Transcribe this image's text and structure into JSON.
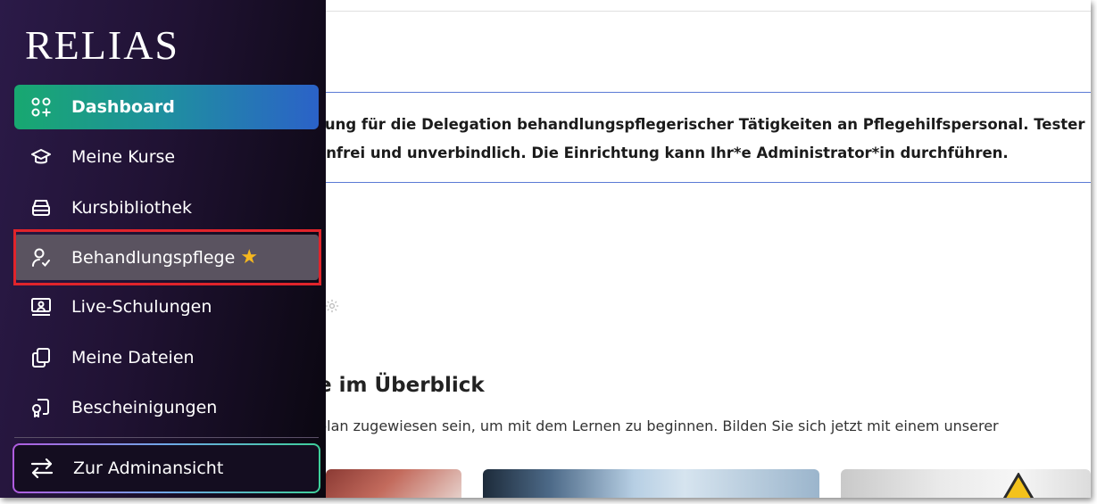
{
  "sidebar": {
    "logo": "RELIAS",
    "items": [
      {
        "label": "Dashboard",
        "icon": "dashboard-icon"
      },
      {
        "label": "Meine Kurse",
        "icon": "graduation-cap-icon"
      },
      {
        "label": "Kursbibliothek",
        "icon": "library-icon"
      },
      {
        "label": "Behandlungspflege",
        "icon": "user-check-icon",
        "badge": "★"
      },
      {
        "label": "Live-Schulungen",
        "icon": "live-training-icon"
      },
      {
        "label": "Meine Dateien",
        "icon": "files-icon"
      },
      {
        "label": "Bescheinigungen",
        "icon": "certificate-icon"
      }
    ],
    "admin_button": {
      "label": "Zur Adminansicht",
      "icon": "switch-arrows-icon"
    },
    "colors": {
      "active_start": "#18a870",
      "active_end": "#2b62c8",
      "highlight_border": "#e0242b",
      "star": "#f6b81f"
    }
  },
  "main": {
    "banner": {
      "line1": "sung für die Delegation behandlungspflegerischer Tätigkeiten an Pflegehilfspersonal. Tester",
      "line2": "enfrei und unverbindlich. Die Einrichtung kann Ihr*e Administrator*in durchführen."
    },
    "section": {
      "title": "e im Überblick",
      "subtitle": "plan zugewiesen sein, um mit dem Lernen zu beginnen. Bilden Sie sich jetzt mit einem unserer"
    }
  }
}
